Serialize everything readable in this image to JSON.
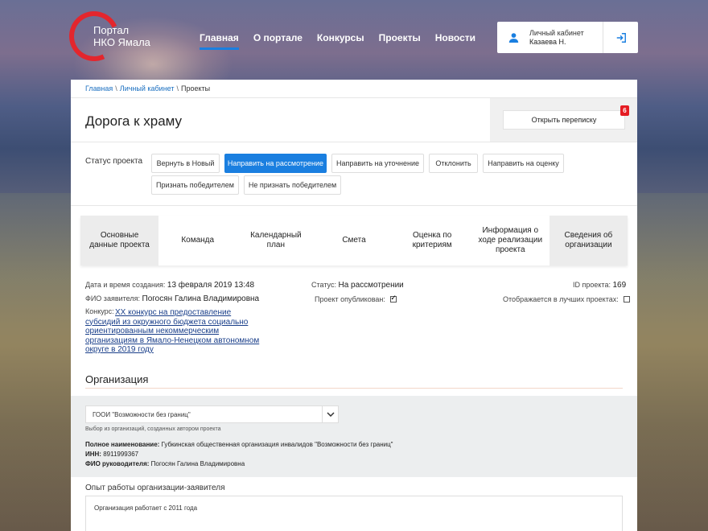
{
  "logo": {
    "line1": "Портал",
    "line2": "НКО Ямала"
  },
  "nav": [
    {
      "label": "Главная",
      "active": true
    },
    {
      "label": "О портале",
      "active": false
    },
    {
      "label": "Конкурсы",
      "active": false
    },
    {
      "label": "Проекты",
      "active": false
    },
    {
      "label": "Новости",
      "active": false
    }
  ],
  "account": {
    "title": "Личный кабинет",
    "name": "Казаева Н."
  },
  "breadcrumb": {
    "home": "Главная",
    "cabinet": "Личный кабинет",
    "current": "Проекты",
    "sep": "\\"
  },
  "project": {
    "title": "Дорога к храму"
  },
  "correspondence": {
    "label": "Открыть переписку",
    "badge": "6"
  },
  "status": {
    "label": "Статус проекта",
    "buttons": [
      "Вернуть в Новый",
      "Направить на рассмотрение",
      "Направить на уточнение",
      "Отклонить",
      "Направить на оценку",
      "Признать победителем",
      "Не признать победителем"
    ]
  },
  "tabs": [
    "Основные данные проекта",
    "Команда",
    "Календарный план",
    "Смета",
    "Оценка по критериям",
    "Информация о ходе реализации проекта",
    "Сведения об организации"
  ],
  "info": {
    "created_label": "Дата и время создания:",
    "created_value": "13 февраля 2019 13:48",
    "applicant_label": "ФИО заявителя:",
    "applicant_value": "Погосян Галина Владимировна",
    "contest_label": "Конкурс:",
    "contest_value": "XX конкурс на предоставление субсидий из окружного бюджета социально ориентированным некоммерческим организациям в Ямало-Ненецком автономном округе в 2019 году",
    "status_label": "Статус:",
    "status_value": "На рассмотрении",
    "published_label": "Проект опубликован:",
    "id_label": "ID проекта:",
    "id_value": "169",
    "best_label": "Отображается в лучших проектах:"
  },
  "org": {
    "title": "Организация",
    "select_value": "ГООИ \"Возможности без границ\"",
    "hint": "Выбор из организаций, созданных автором проекта",
    "fullname_label": "Полное наименование:",
    "fullname_value": "Губкинская общественная организация инвалидов \"Возможности без границ\"",
    "inn_label": "ИНН:",
    "inn_value": "8911999367",
    "head_label": "ФИО руководителя:",
    "head_value": "Погосян Галина Владимировна"
  },
  "experience": {
    "label": "Опыт работы организации-заявителя",
    "value": "Организация работает с 2011 года"
  },
  "colors": {
    "accent": "#1a7fe0",
    "logo_red": "#e3262d",
    "badge": "#e51c23"
  }
}
